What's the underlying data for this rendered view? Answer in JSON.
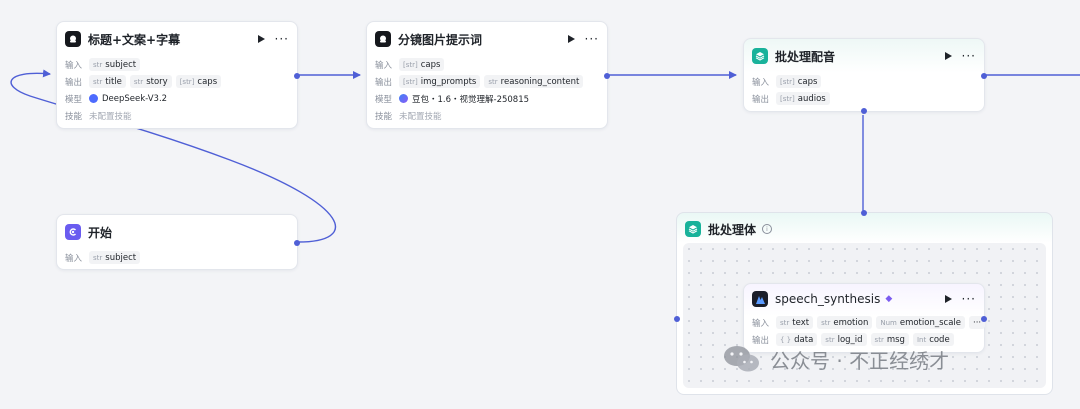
{
  "colors": {
    "edge": "#4f5fd6",
    "teal": "#18b29a",
    "purple": "#6a5cf0"
  },
  "nodes": {
    "title_copy": {
      "title": "标题+文案+字幕",
      "input_label": "输入",
      "inputs": [
        {
          "type": "str",
          "name": "subject"
        }
      ],
      "output_label": "输出",
      "outputs": [
        {
          "type": "str",
          "name": "title"
        },
        {
          "type": "str",
          "name": "story"
        },
        {
          "type": "[str]",
          "name": "caps"
        }
      ],
      "model_label": "模型",
      "model": "DeepSeek-V3.2",
      "skill_label": "技能",
      "skill": "未配置技能"
    },
    "storyboard": {
      "title": "分镜图片提示词",
      "input_label": "输入",
      "inputs": [
        {
          "type": "[str]",
          "name": "caps"
        }
      ],
      "output_label": "输出",
      "outputs": [
        {
          "type": "[str]",
          "name": "img_prompts"
        },
        {
          "type": "str",
          "name": "reasoning_content"
        }
      ],
      "model_label": "模型",
      "model": "豆包・1.6・视觉理解-250815",
      "skill_label": "技能",
      "skill": "未配置技能"
    },
    "batch_dub": {
      "title": "批处理配音",
      "input_label": "输入",
      "inputs": [
        {
          "type": "[str]",
          "name": "caps"
        }
      ],
      "output_label": "输出",
      "outputs": [
        {
          "type": "[str]",
          "name": "audios"
        }
      ]
    },
    "start": {
      "title": "开始",
      "input_label": "输入",
      "inputs": [
        {
          "type": "str",
          "name": "subject"
        }
      ]
    },
    "batch_body": {
      "title": "批处理体"
    },
    "speech": {
      "title": "speech_synthesis",
      "input_label": "输入",
      "inputs": [
        {
          "type": "str",
          "name": "text"
        },
        {
          "type": "str",
          "name": "emotion"
        },
        {
          "type": "Num",
          "name": "emotion_scale"
        }
      ],
      "output_label": "输出",
      "outputs": [
        {
          "type": "{ }",
          "name": "data"
        },
        {
          "type": "str",
          "name": "log_id"
        },
        {
          "type": "str",
          "name": "msg"
        },
        {
          "type": "Int",
          "name": "code"
        }
      ]
    }
  },
  "watermark": {
    "text": "公众号 · 不正经绣才"
  },
  "icons": [
    "play-icon",
    "more-icon",
    "node-logo-icon",
    "info-icon",
    "diamond-icon"
  ]
}
